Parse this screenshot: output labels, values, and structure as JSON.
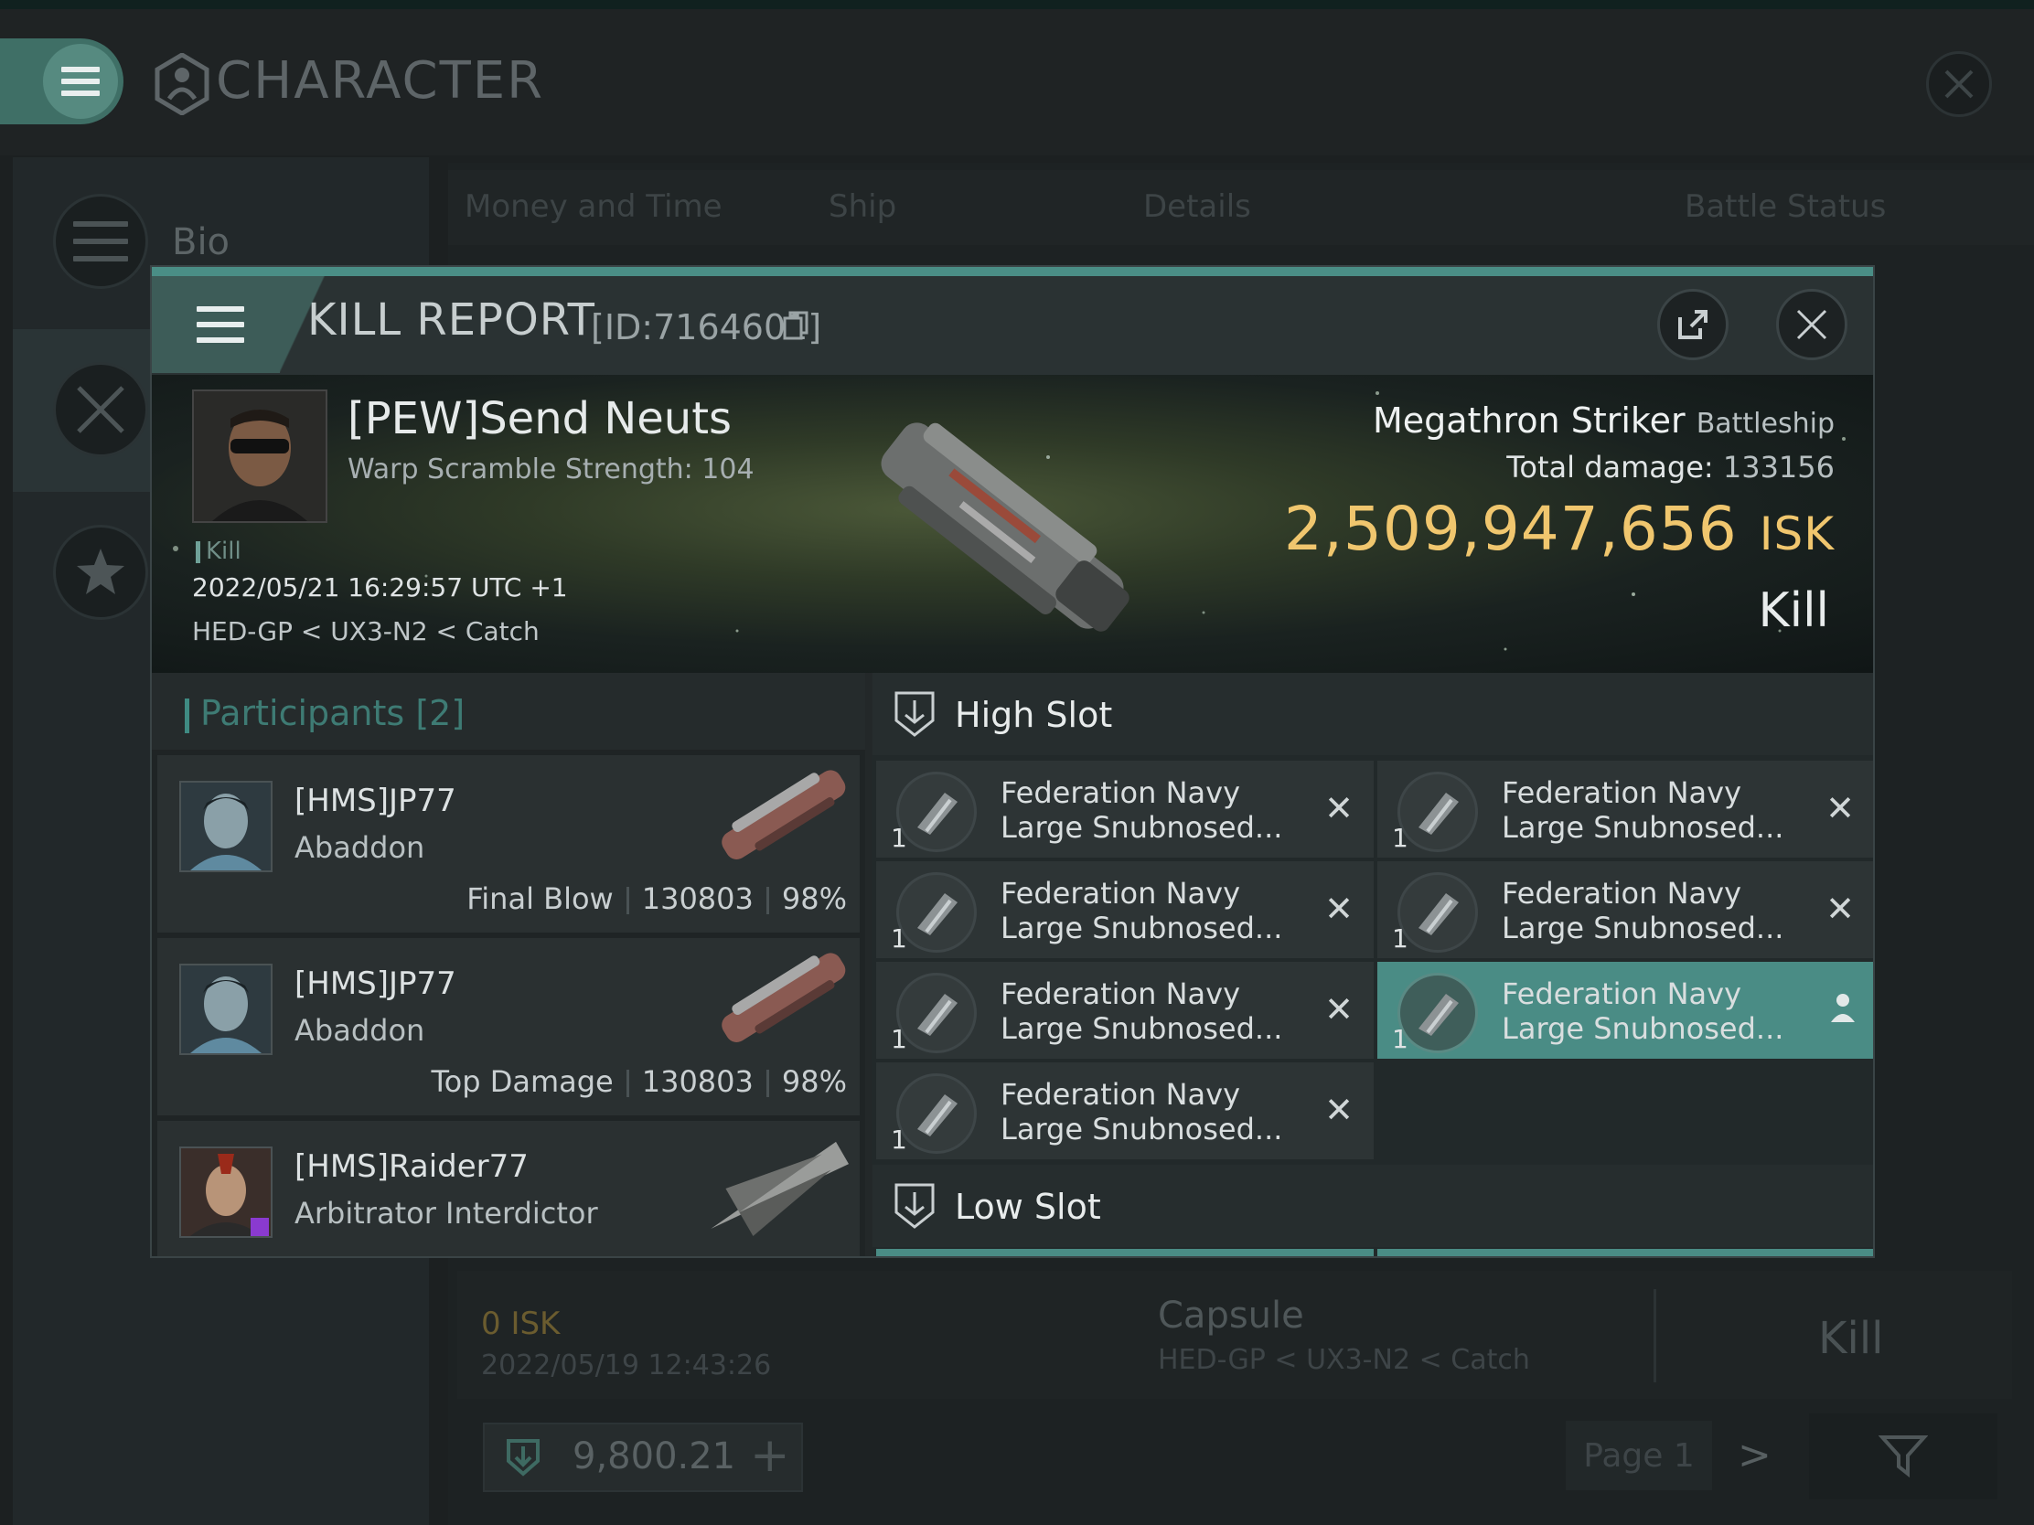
{
  "app": {
    "title": "CHARACTER",
    "sidebar": [
      {
        "label": "Bio"
      }
    ],
    "tabs": [
      "Money and Time",
      "Ship",
      "Details",
      "Battle Status"
    ],
    "bg_row": {
      "isk": "0 ISK",
      "date": "2022/05/19 12:43:26",
      "ship": "Capsule",
      "location": "HED-GP < UX3-N2 < Catch",
      "result": "Kill"
    },
    "balance": "9,800.21",
    "page": "Page 1"
  },
  "kill_report": {
    "title": "KILL REPORT",
    "id": "[ID:7164601]",
    "victim": {
      "name": "[PEW]Send Neuts",
      "warp": "Warp Scramble Strength: 104",
      "tag": "Kill",
      "datetime": "2022/05/21 16:29:57 UTC +1",
      "location": "HED-GP < UX3-N2 < Catch"
    },
    "ship": {
      "name": "Megathron Striker",
      "class": "Battleship",
      "total_damage_label": "Total damage:",
      "total_damage": "133156",
      "isk_value": "2,509,947,656",
      "isk_unit": "ISK",
      "result": "Kill"
    },
    "participants": {
      "label": "Participants",
      "count": "[2]",
      "rows": [
        {
          "name": "[HMS]JP77",
          "ship": "Abaddon",
          "role": "Final Blow",
          "damage": "130803",
          "pct": "98%"
        },
        {
          "name": "[HMS]JP77",
          "ship": "Abaddon",
          "role": "Top Damage",
          "damage": "130803",
          "pct": "98%"
        },
        {
          "name": "[HMS]Raider77",
          "ship": "Arbitrator Interdictor",
          "role": "",
          "damage": "",
          "pct": ""
        }
      ]
    },
    "slots": {
      "high": {
        "title": "High Slot",
        "items": [
          {
            "qty": "1",
            "line1": "Federation Navy",
            "line2": "Large Snubnosed...",
            "status": "destroyed"
          },
          {
            "qty": "1",
            "line1": "Federation Navy",
            "line2": "Large Snubnosed...",
            "status": "destroyed"
          },
          {
            "qty": "1",
            "line1": "Federation Navy",
            "line2": "Large Snubnosed...",
            "status": "destroyed"
          },
          {
            "qty": "1",
            "line1": "Federation Navy",
            "line2": "Large Snubnosed...",
            "status": "destroyed"
          },
          {
            "qty": "1",
            "line1": "Federation Navy",
            "line2": "Large Snubnosed...",
            "status": "destroyed"
          },
          {
            "qty": "1",
            "line1": "Federation Navy",
            "line2": "Large Snubnosed...",
            "status": "dropped"
          },
          {
            "qty": "1",
            "line1": "Federation Navy",
            "line2": "Large Snubnosed...",
            "status": "destroyed"
          }
        ]
      },
      "low": {
        "title": "Low Slot"
      }
    }
  },
  "colors": {
    "accent": "#4a8c85",
    "isk": "#f0c66e",
    "bg": "#1c2021"
  },
  "icons": [
    "menu-icon",
    "character-icon",
    "close-icon",
    "export-icon",
    "copy-icon",
    "shield-icon",
    "star-icon",
    "swords-icon",
    "filter-icon",
    "person-icon"
  ]
}
